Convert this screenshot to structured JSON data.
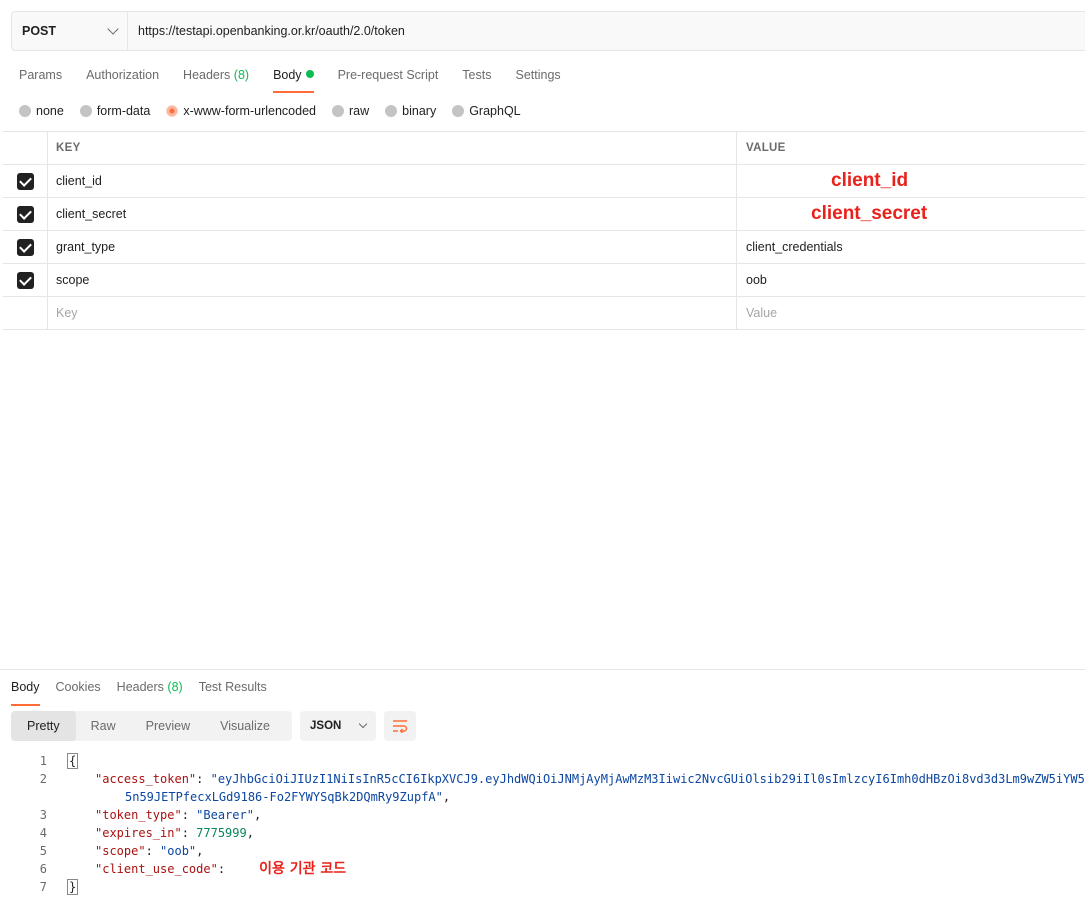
{
  "request": {
    "method": "POST",
    "url": "https://testapi.openbanking.or.kr/oauth/2.0/token"
  },
  "request_tabs": [
    {
      "label": "Params"
    },
    {
      "label": "Authorization"
    },
    {
      "label": "Headers",
      "count": "(8)"
    },
    {
      "label": "Body"
    },
    {
      "label": "Pre-request Script"
    },
    {
      "label": "Tests"
    },
    {
      "label": "Settings"
    }
  ],
  "body_types": [
    "none",
    "form-data",
    "x-www-form-urlencoded",
    "raw",
    "binary",
    "GraphQL"
  ],
  "table": {
    "key_header": "KEY",
    "value_header": "VALUE",
    "rows": [
      {
        "key": "client_id",
        "value": "client_id"
      },
      {
        "key": "client_secret",
        "value": "client_secret"
      },
      {
        "key": "grant_type",
        "value": "client_credentials"
      },
      {
        "key": "scope",
        "value": "oob"
      }
    ],
    "key_placeholder": "Key",
    "value_placeholder": "Value"
  },
  "response_tabs": [
    {
      "label": "Body"
    },
    {
      "label": "Cookies"
    },
    {
      "label": "Headers",
      "count": "(8)"
    },
    {
      "label": "Test Results"
    }
  ],
  "view_modes": [
    "Pretty",
    "Raw",
    "Preview",
    "Visualize"
  ],
  "format": "JSON",
  "code": {
    "line_numbers": [
      "1",
      "2",
      "3",
      "4",
      "5",
      "6",
      "7"
    ],
    "open_brace": "{",
    "close_brace": "}",
    "access_token_key": "\"access_token\"",
    "access_token_value": "\"eyJhbGciOiJIUzI1NiIsInR5cCI6IkpXVCJ9.eyJhdWQiOiJNMjAyMjAwMzM3Iiwic2NvcGUiOlsib29iIl0sImlzcyI6Imh0dHBzOi8vd3d3Lm9wZW5iYW5",
    "access_token_cont": "5n59JETPfecxLGd9186-Fo2FYWYSqBk2DQmRy9ZupfA\"",
    "token_type_key": "\"token_type\"",
    "token_type_value": "\"Bearer\"",
    "expires_in_key": "\"expires_in\"",
    "expires_in_value": "7775999",
    "scope_key": "\"scope\"",
    "scope_value": "\"oob\"",
    "client_use_code_key": "\"client_use_code\"",
    "client_use_code_value": "이용 기관 코드"
  }
}
